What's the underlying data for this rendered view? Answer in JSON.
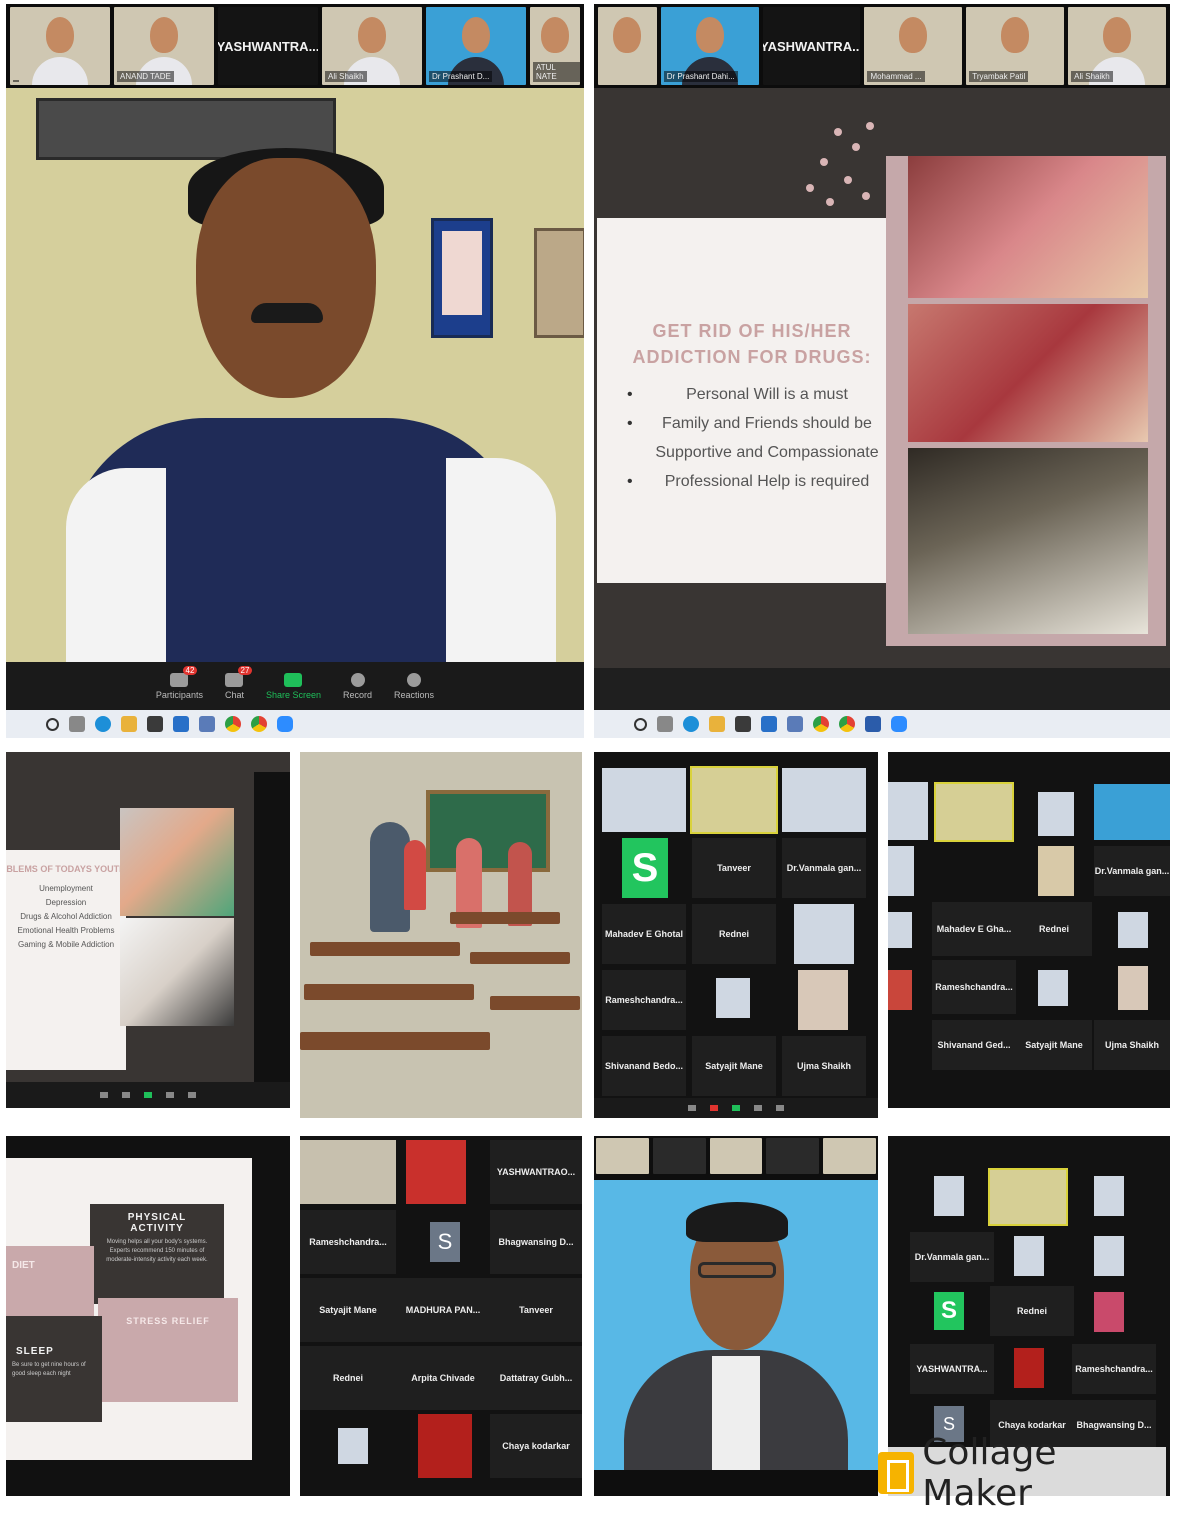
{
  "panel1": {
    "strip_name": "YASHWANTRA...",
    "strip_tags": [
      "",
      "ANAND TADE",
      "",
      "Ali Shaikh",
      "Dr Prashant D...",
      "ATUL NATE"
    ],
    "toolbar": [
      {
        "icon": "participants-icon",
        "label": "Participants",
        "badge": "42"
      },
      {
        "icon": "chat-icon",
        "label": "Chat",
        "badge": "27"
      },
      {
        "icon": "share-screen-icon",
        "label": "Share Screen",
        "badge": ""
      },
      {
        "icon": "record-icon",
        "label": "Record",
        "badge": ""
      },
      {
        "icon": "reactions-icon",
        "label": "Reactions",
        "badge": ""
      }
    ]
  },
  "panel2": {
    "strip_name": "YASHWANTRA...",
    "strip_tags": [
      "",
      "Dr Prashant Dahi...",
      "",
      "Mohammad ...",
      "Tryambak Patil",
      "Ali Shaikh"
    ],
    "slide_title": "GET RID OF HIS/HER ADDICTION FOR DRUGS:",
    "bullets": [
      "Personal Will is a must",
      "Family and Friends should be Supportive and Compassionate",
      "Professional Help is required"
    ]
  },
  "panel3": {
    "slide_title": "BLEMS OF TODAYS YOUTH",
    "items": [
      "Unemployment",
      "Depression",
      "Drugs & Alcohol Addiction",
      "Emotional Health Problems",
      "Gaming & Mobile Addiction"
    ]
  },
  "panel5": {
    "cells": [
      "",
      "",
      "",
      "S",
      "Tanveer",
      "Dr.Vanmala gan...",
      "Mahadev E Ghotal",
      "Rednei",
      "",
      "Rameshchandra...",
      "",
      "",
      "Shivanand Bedo...",
      "Satyajit Mane",
      "Ujma Shaikh"
    ]
  },
  "panel6": {
    "cells": [
      "Dr.Vanmala gan...",
      "Mahadev E Gha...",
      "Rednei",
      "Rameshchandra...",
      "Shivanand Ged...",
      "Satyajit Mane",
      "Ujma Shaikh"
    ]
  },
  "panel7": {
    "cards": [
      {
        "title": "PHYSICAL ACTIVITY",
        "text": "Moving helps all your body's systems. Experts recommend 150 minutes of moderate-intensity activity each week."
      },
      {
        "title": "DIET",
        "text": ""
      },
      {
        "title": "STRESS RELIEF",
        "text": ""
      },
      {
        "title": "SLEEP",
        "text": "Be sure to get nine hours of good sleep each night"
      }
    ]
  },
  "panel8": {
    "cells": [
      "",
      "",
      "YASHWANTRAO...",
      "Rameshchandra...",
      "S",
      "Bhagwansing D...",
      "Satyajit Mane",
      "MADHURA PAN...",
      "Tanveer",
      "Rednei",
      "Arpita Chivade",
      "Dattatray Gubh...",
      "",
      "",
      "Chaya kodarkar"
    ]
  },
  "panel10": {
    "cells": [
      "",
      "",
      "",
      "Dr.Vanmala gan...",
      "",
      "",
      "S",
      "Rednei",
      "",
      "YASHWANTRA...",
      "",
      "Rameshchandra...",
      "S",
      "Chaya kodarkar",
      "Bhagwansing D..."
    ]
  },
  "watermark": "Collage Maker"
}
